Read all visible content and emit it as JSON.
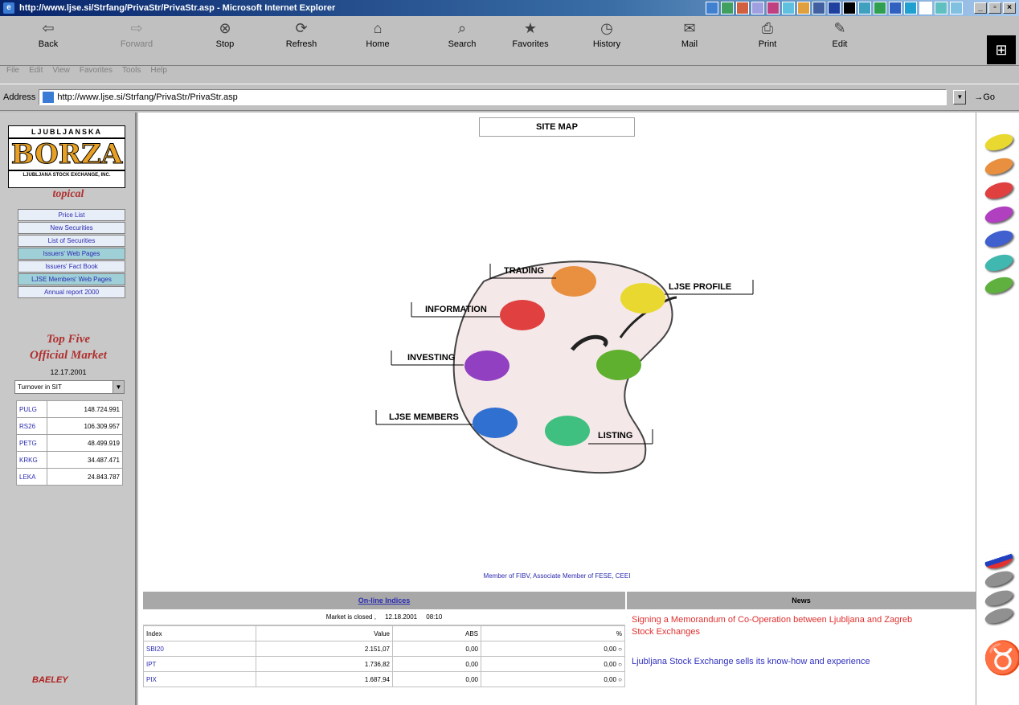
{
  "window": {
    "title": "http://www.ljse.si/Strfang/PrivaStr/PrivaStr.asp - Microsoft Internet Explorer"
  },
  "toolbar": {
    "buttons": [
      "Back",
      "Forward",
      "Stop",
      "Refresh",
      "Home",
      "Search",
      "Favorites",
      "History",
      "Mail",
      "Print",
      "Edit"
    ],
    "menu": [
      "File",
      "Edit",
      "View",
      "Favorites",
      "Tools",
      "Help"
    ]
  },
  "address": {
    "label": "Address",
    "url": "http://www.ljse.si/Strfang/PrivaStr/PrivaStr.asp",
    "go": "Go"
  },
  "left": {
    "logo_top": "LJUBLJANSKA",
    "logo_main": "BORZA",
    "logo_bottom": "LJUBLJANA STOCK EXCHANGE, INC.",
    "topical_title": "topical",
    "menu": [
      "Price List",
      "New Securities",
      "List of Securities",
      "Issuers' Web Pages",
      "Issuers' Fact Book",
      "LJSE Members' Web Pages",
      "Annual report 2000"
    ],
    "top_five_line1": "Top Five",
    "top_five_line2": "Official Market",
    "top_five_date": "12.17.2001",
    "select_value": "Turnover in SIT",
    "top_five": [
      {
        "symbol": "PULG",
        "value": "148.724.991"
      },
      {
        "symbol": "RS26",
        "value": "106.309.957"
      },
      {
        "symbol": "PETG",
        "value": "48.499.919"
      },
      {
        "symbol": "KRKG",
        "value": "34.487.471"
      },
      {
        "symbol": "LEKA",
        "value": "24.843.787"
      }
    ],
    "sponsor": "BAELEY"
  },
  "main": {
    "site_map_title": "SITE MAP",
    "palette_labels": {
      "trading": "TRADING",
      "ljse_profile": "LJSE PROFILE",
      "information": "INFORMATION",
      "investing": "INVESTING",
      "ljse_members": "LJSE MEMBERS",
      "listing": "LISTING"
    },
    "member_text": "Member of FIBV, Associate Member of FESE, CEEI",
    "indices": {
      "title": "On-line Indices",
      "status_label": "Market is closed ,",
      "status_date": "12.18.2001",
      "status_time": "08:10",
      "headers": [
        "Index",
        "Value",
        "ABS",
        "%"
      ],
      "rows": [
        {
          "index": "SBI20",
          "value": "2.151,07",
          "abs": "0,00",
          "pct": "0,00"
        },
        {
          "index": "IPT",
          "value": "1.736,82",
          "abs": "0,00",
          "pct": "0,00"
        },
        {
          "index": "PIX",
          "value": "1.687,94",
          "abs": "0,00",
          "pct": "0,00"
        }
      ]
    },
    "news": {
      "title": "News",
      "items": [
        "Signing a Memorandum of Co-Operation between Ljubljana and Zagreb Stock Exchanges",
        "Ljubljana Stock Exchange sells its know-how and experience"
      ]
    }
  },
  "colors": {
    "blobs": [
      "#e8d830",
      "#e89040",
      "#e04040",
      "#b040c0",
      "#4060d0",
      "#40b8b0",
      "#60b040"
    ]
  }
}
